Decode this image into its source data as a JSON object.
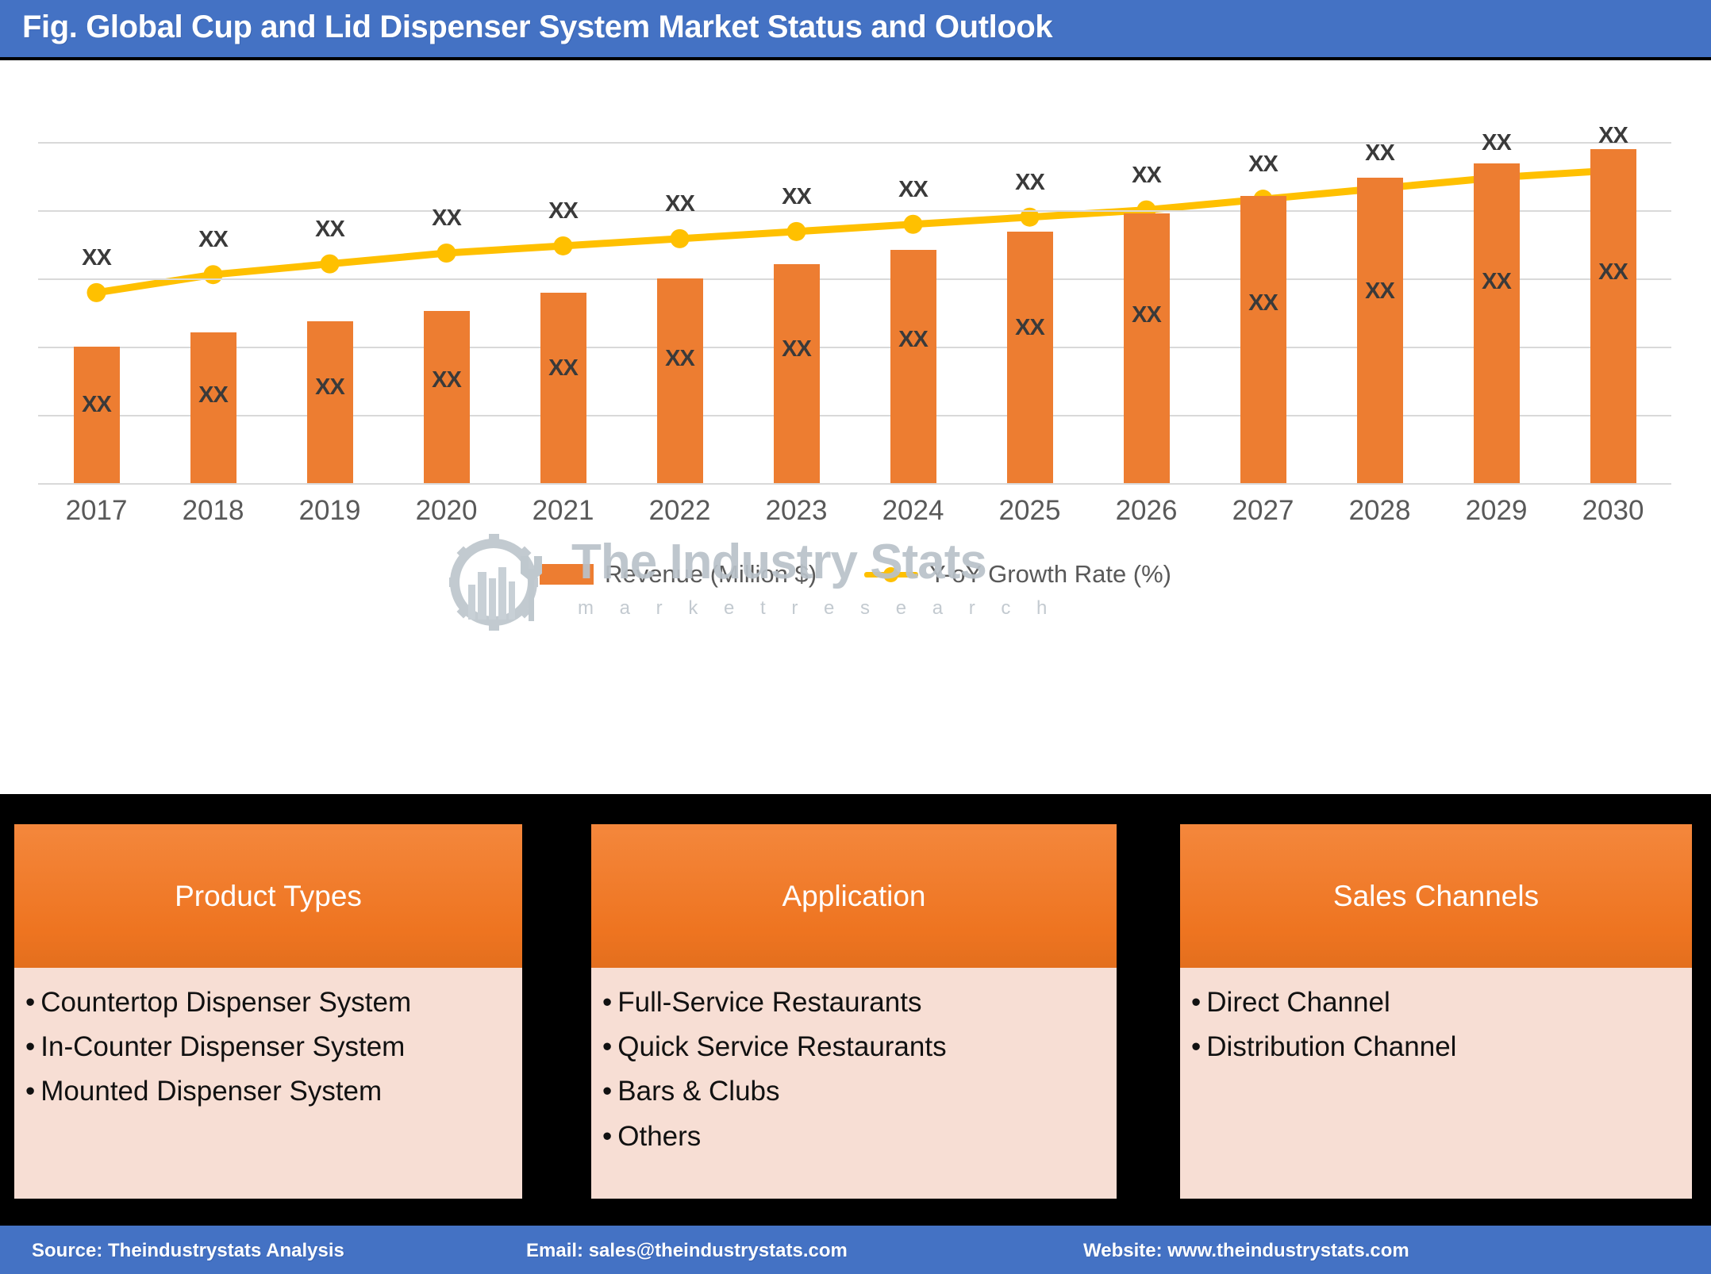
{
  "header": {
    "title": "Fig. Global Cup and Lid Dispenser System Market Status and Outlook",
    "bg_color": "#4472C4"
  },
  "chart_data": {
    "type": "bar",
    "title": "Fig. Global Cup and Lid Dispenser System Market Status and Outlook",
    "xlabel": "",
    "ylabel": "",
    "grid": true,
    "legend_position": "bottom",
    "categories": [
      "2017",
      "2018",
      "2019",
      "2020",
      "2021",
      "2022",
      "2023",
      "2024",
      "2025",
      "2026",
      "2027",
      "2028",
      "2029",
      "2030"
    ],
    "bar_value_labels": [
      "XX",
      "XX",
      "XX",
      "XX",
      "XX",
      "XX",
      "XX",
      "XX",
      "XX",
      "XX",
      "XX",
      "XX",
      "XX",
      "XX"
    ],
    "line_value_labels": [
      "XX",
      "XX",
      "XX",
      "XX",
      "XX",
      "XX",
      "XX",
      "XX",
      "XX",
      "XX",
      "XX",
      "XX",
      "XX",
      "XX"
    ],
    "series": [
      {
        "name": "Revenue (Million $)",
        "kind": "bar",
        "color": "#ED7D31",
        "values": [
          38,
          42,
          45,
          48,
          53,
          57,
          61,
          65,
          70,
          75,
          80,
          85,
          89,
          93
        ]
      },
      {
        "name": "Y-oY Growth Rate (%)",
        "kind": "line",
        "color": "#FFC000",
        "values": [
          53,
          58,
          61,
          64,
          66,
          68,
          70,
          72,
          74,
          76,
          79,
          82,
          85,
          87
        ]
      }
    ],
    "ylim": [
      0,
      113
    ],
    "gridline_values": [
      0,
      19,
      38,
      57,
      76,
      95
    ]
  },
  "legend": {
    "items": [
      {
        "label": "Revenue (Million $)",
        "color": "#ED7D31",
        "type": "bar"
      },
      {
        "label": "Y-oY Growth Rate (%)",
        "color": "#FFC000",
        "type": "line"
      }
    ]
  },
  "watermark": {
    "text": "The Industry Stats",
    "subtext": "m a r k e t     r e s e a r c h"
  },
  "panels": [
    {
      "title": "Product Types",
      "items": [
        "Countertop Dispenser System",
        "In-Counter Dispenser System",
        "Mounted Dispenser System"
      ]
    },
    {
      "title": "Application",
      "items": [
        "Full-Service Restaurants",
        "Quick Service Restaurants",
        "Bars & Clubs",
        "Others"
      ]
    },
    {
      "title": "Sales Channels",
      "items": [
        "Direct Channel",
        "Distribution Channel"
      ]
    }
  ],
  "footer": {
    "source": "Source: Theindustrystats Analysis",
    "email": "Email: sales@theindustrystats.com",
    "website": "Website: www.theindustrystats.com",
    "bg_color": "#4472C4"
  }
}
